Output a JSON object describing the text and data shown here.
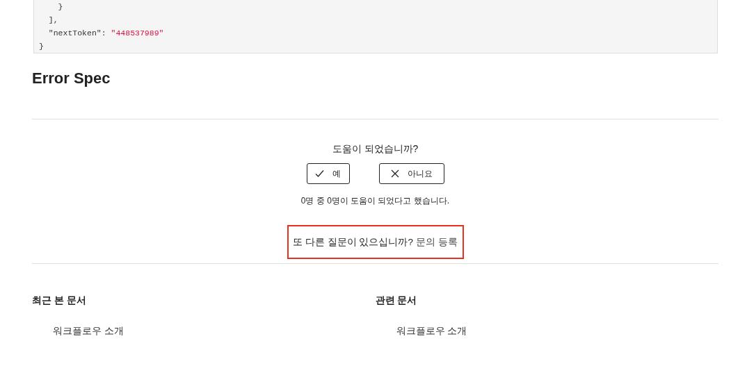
{
  "code_block": {
    "lines": [
      [
        {
          "kind": "plain",
          "text": "    }"
        }
      ],
      [
        {
          "kind": "plain",
          "text": "  ],"
        }
      ],
      [
        {
          "kind": "plain",
          "text": "  \"nextToken\": "
        },
        {
          "kind": "string",
          "text": "\"448537989\""
        }
      ],
      [
        {
          "kind": "plain",
          "text": "}"
        }
      ]
    ]
  },
  "section_heading": "Error Spec",
  "feedback": {
    "question": "도움이 되었습니까?",
    "buttons": [
      {
        "kind": "yes",
        "label": "예"
      },
      {
        "kind": "no",
        "label": "아니요"
      }
    ],
    "stats": "0명 중 0명이 도움이 되었다고 했습니다.",
    "more_question": "또 다른 질문이 있으십니까?",
    "inquiry_link": "문의 등록"
  },
  "related": [
    {
      "title": "최근 본 문서",
      "items": [
        "워크플로우 소개"
      ]
    },
    {
      "title": "관련 문서",
      "items": [
        "워크플로우 소개"
      ]
    }
  ]
}
